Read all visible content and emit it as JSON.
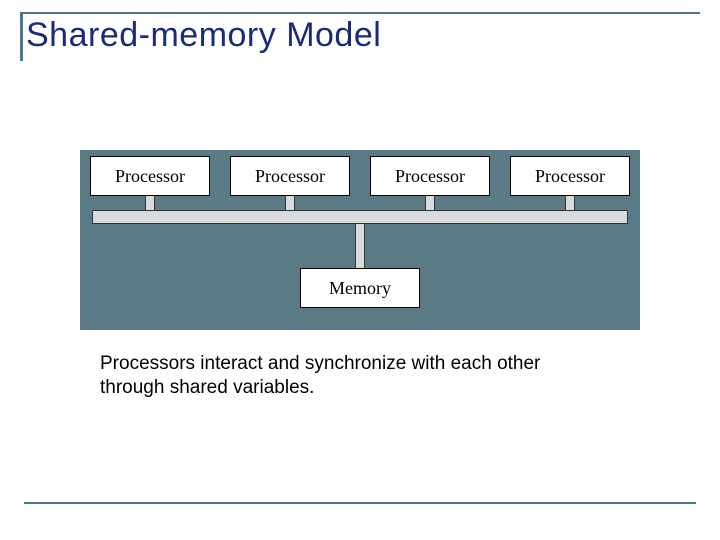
{
  "title": "Shared-memory Model",
  "diagram": {
    "processors": [
      "Processor",
      "Processor",
      "Processor",
      "Processor"
    ],
    "memory_label": "Memory"
  },
  "caption": "Processors interact and synchronize with each other through shared variables."
}
